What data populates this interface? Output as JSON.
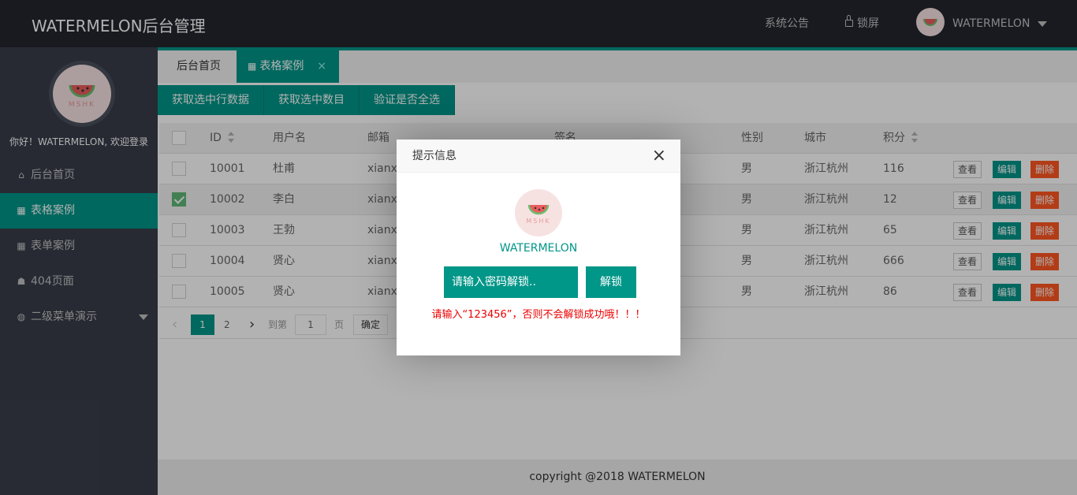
{
  "header": {
    "logo": "WATERMELON后台管理",
    "notice": "系统公告",
    "lock": "锁屏",
    "user": "WATERMELON"
  },
  "sidebar": {
    "welcome": "你好！WATERMELON, 欢迎登录",
    "avatar_text": "MSHK",
    "items": [
      {
        "label": "后台首页",
        "icon": "home-icon"
      },
      {
        "label": "表格案例",
        "icon": "table-icon"
      },
      {
        "label": "表单案例",
        "icon": "table-icon"
      },
      {
        "label": "404页面",
        "icon": "bug-icon"
      },
      {
        "label": "二级菜单演示",
        "icon": "globe-icon"
      }
    ]
  },
  "tabs": [
    {
      "label": "后台首页"
    },
    {
      "label": "表格案例",
      "close": "×"
    }
  ],
  "toolbar": {
    "get_row_data": "获取选中行数据",
    "get_count": "获取选中数目",
    "check_all": "验证是否全选"
  },
  "table": {
    "headers": {
      "id": "ID",
      "username": "用户名",
      "email": "邮箱",
      "sign": "签名",
      "sex": "性别",
      "city": "城市",
      "score": "积分"
    },
    "rows": [
      {
        "id": "10001",
        "username": "杜甫",
        "email": "xianxi",
        "sex": "男",
        "city": "浙江杭州",
        "score": "116",
        "checked": false
      },
      {
        "id": "10002",
        "username": "李白",
        "email": "xianxi",
        "sex": "男",
        "city": "浙江杭州",
        "score": "12",
        "checked": true
      },
      {
        "id": "10003",
        "username": "王勃",
        "email": "xianxi",
        "sex": "男",
        "city": "浙江杭州",
        "score": "65",
        "checked": false
      },
      {
        "id": "10004",
        "username": "贤心",
        "email": "xianxi",
        "sex": "男",
        "city": "浙江杭州",
        "score": "666",
        "checked": false
      },
      {
        "id": "10005",
        "username": "贤心",
        "email": "xianxi",
        "sex": "男",
        "city": "浙江杭州",
        "score": "86",
        "checked": false
      }
    ],
    "actions": {
      "view": "查看",
      "edit": "编辑",
      "delete": "删除"
    }
  },
  "pager": {
    "prev": "‹",
    "page1": "1",
    "page2": "2",
    "next": "›",
    "goto": "到第",
    "goto_value": "1",
    "page_unit": "页",
    "confirm": "确定"
  },
  "footer": "copyright @2018 WATERMELON",
  "dialog": {
    "title": "提示信息",
    "close": "×",
    "name": "WATERMELON",
    "avatar_text": "MSHK",
    "password_placeholder": "请输入密码解锁..",
    "unlock": "解锁",
    "tip": "请输入“123456”，否则不会解锁成功哦！！！"
  },
  "colors": {
    "accent": "#009688",
    "danger": "#ff5722",
    "header_bg": "#23262e",
    "sidebar_bg": "#393d49",
    "tip": "#ee0000"
  }
}
